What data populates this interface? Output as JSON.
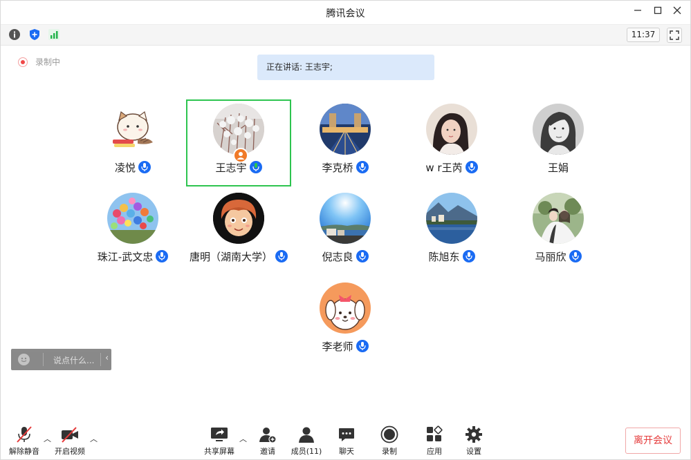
{
  "window": {
    "title": "腾讯会议",
    "controls": [
      "minimize-icon",
      "maximize-icon",
      "close-icon"
    ]
  },
  "toolbar": {
    "icons": [
      "info-icon",
      "shield-icon",
      "signal-icon"
    ],
    "time": "11:37",
    "fullscreen_icon": "fullscreen-icon"
  },
  "recording": {
    "label": "录制中"
  },
  "speaking": {
    "label": "正在讲话: 王志宇;"
  },
  "participants": [
    {
      "name": "凌悦",
      "mic": "on"
    },
    {
      "name": "王志宇",
      "mic": "speaking",
      "host": true,
      "active": true
    },
    {
      "name": "李克桥",
      "mic": "on"
    },
    {
      "name": "w r王芮",
      "mic": "on"
    },
    {
      "name": "王娟",
      "mic": "none"
    },
    {
      "name": "珠江-武文忠",
      "mic": "on"
    },
    {
      "name": "唐明（湖南大学）",
      "mic": "on"
    },
    {
      "name": "倪志良",
      "mic": "on"
    },
    {
      "name": "陈旭东",
      "mic": "on"
    },
    {
      "name": "马丽欣",
      "mic": "on"
    },
    {
      "name": "李老师",
      "mic": "on"
    }
  ],
  "chat": {
    "placeholder": "说点什么..."
  },
  "bottom_bar": {
    "unmute": "解除静音",
    "start_video": "开启视频",
    "share_screen": "共享屏幕",
    "invite": "邀请",
    "members": "成员(11)",
    "chat": "聊天",
    "record": "录制",
    "apps": "应用",
    "settings": "设置",
    "leave": "离开会议"
  },
  "colors": {
    "accent": "#1a6bf3",
    "active_border": "#2dc44f",
    "leave": "#e53b3b",
    "speaking_bg": "#dbe9fb"
  }
}
